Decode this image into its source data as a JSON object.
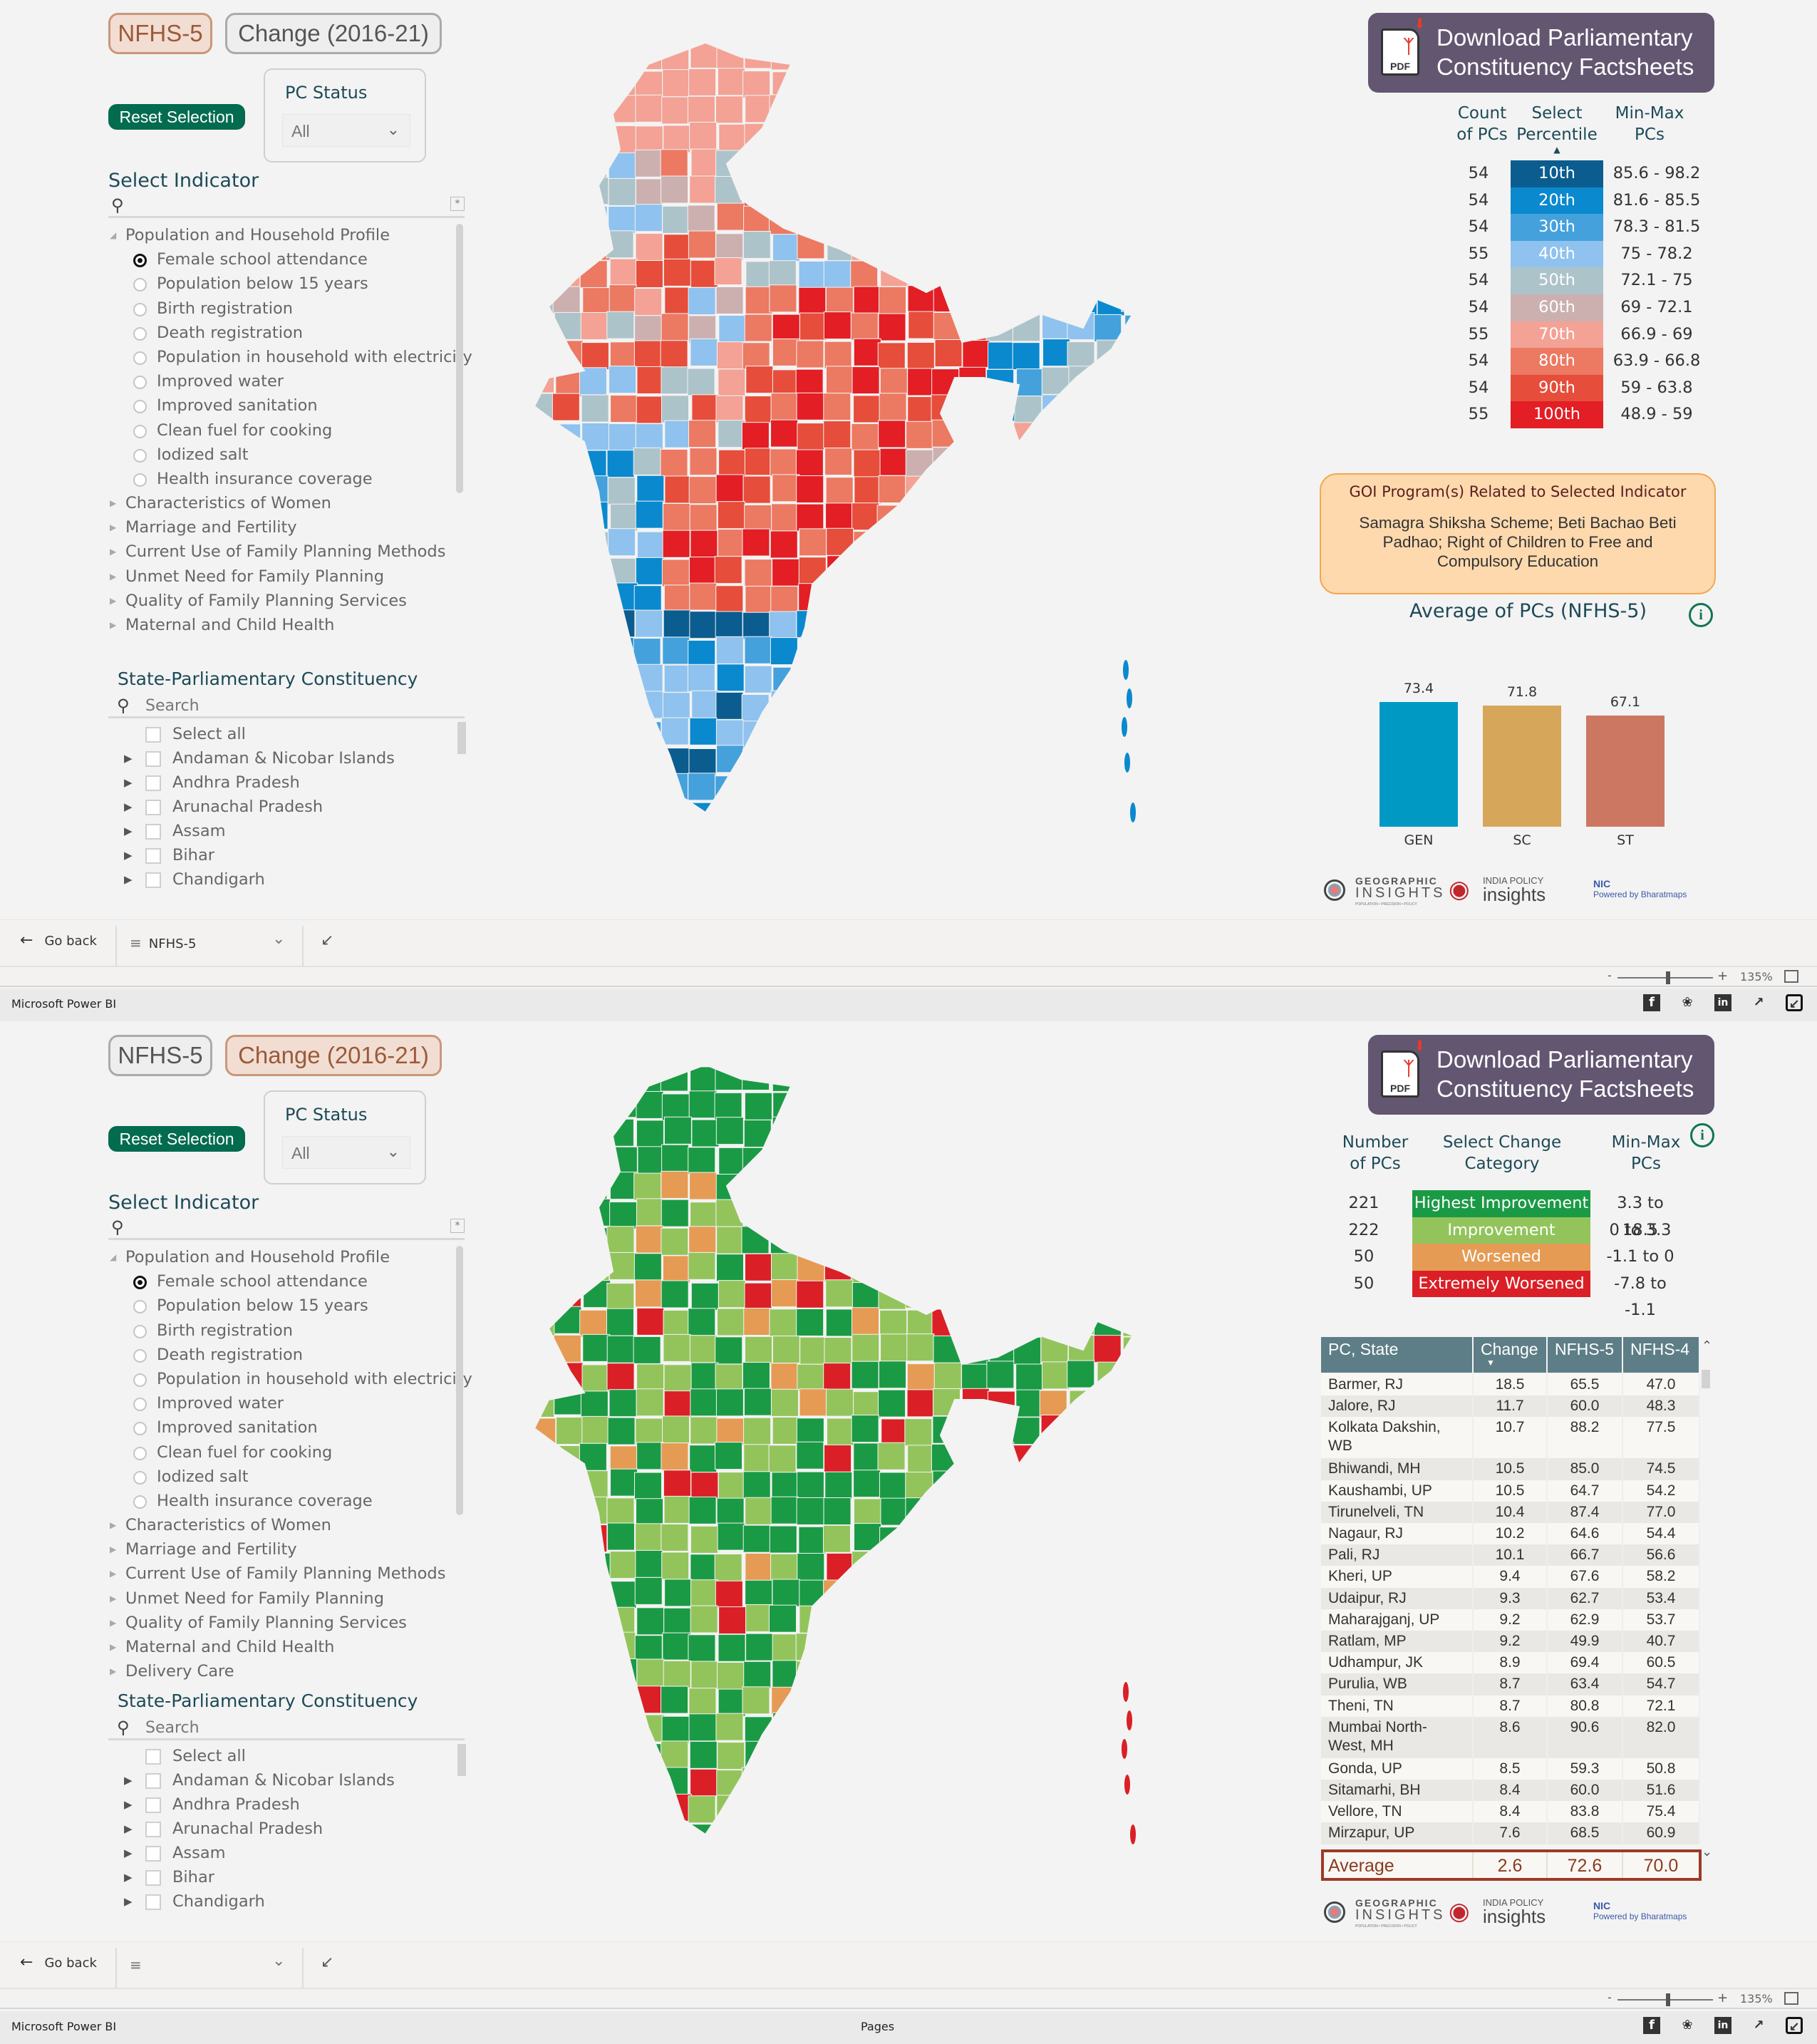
{
  "app": {
    "name": "Microsoft Power BI",
    "pages_label": "Pages"
  },
  "common": {
    "tabs": [
      {
        "label": "NFHS-5"
      },
      {
        "label": "Change (2016-21)"
      }
    ],
    "reset_label": "Reset Selection",
    "pc_status": {
      "title": "PC Status",
      "value": "All"
    },
    "select_indicator_title": "Select Indicator",
    "indicator_tree": {
      "expanded_group": "Population and Household Profile",
      "selected": "Female school attendance",
      "items": [
        "Female school attendance",
        "Population below 15 years",
        "Birth registration",
        "Death registration",
        "Population in household with electricity",
        "Improved water",
        "Improved sanitation",
        "Clean fuel for cooking",
        "Iodized salt",
        "Health insurance coverage"
      ],
      "collapsed_groups": [
        "Characteristics of Women",
        "Marriage and Fertility",
        "Current Use of Family Planning Methods",
        "Unmet Need for Family Planning",
        "Quality of Family Planning Services",
        "Maternal and Child Health",
        "Delivery Care"
      ]
    },
    "state_pc_title": "State-Parliamentary Constituency",
    "state_search_placeholder": "Search",
    "state_list": [
      "Select all",
      "Andaman & Nicobar Islands",
      "Andhra Pradesh",
      "Arunachal Pradesh",
      "Assam",
      "Bihar",
      "Chandigarh"
    ],
    "download_label_1": "Download Parliamentary",
    "download_label_2": "Constituency Factsheets",
    "pdf_label": "PDF",
    "logos": {
      "gi_top": "GEOGRAPHIC",
      "gi_main": "INSIGHTS",
      "gi_tag": "POPULATION • PRECISION • POLICY",
      "ipi_top": "INDIA POLICY",
      "ipi_main": "insights",
      "nic_top": "NIC",
      "nic_main": "Powered by Bharatmaps"
    },
    "go_back": "Go back",
    "zoom": {
      "percent": "135%",
      "level": 0.5
    }
  },
  "panel1": {
    "page_selector": "NFHS-5",
    "visible_indicator_groups": 6,
    "legend_headers": {
      "count": [
        "Count",
        "of PCs"
      ],
      "select": [
        "Select",
        "Percentile"
      ],
      "minmax": [
        "Min-Max",
        "PCs"
      ]
    },
    "legend": [
      {
        "count": "54",
        "label": "10th",
        "range": "85.6 - 98.2",
        "color": "#0b5d8f"
      },
      {
        "count": "54",
        "label": "20th",
        "range": "81.6 - 85.5",
        "color": "#0a89cf"
      },
      {
        "count": "54",
        "label": "30th",
        "range": "78.3 - 81.5",
        "color": "#44a1dc"
      },
      {
        "count": "55",
        "label": "40th",
        "range": "75 - 78.2",
        "color": "#8fc2ee"
      },
      {
        "count": "54",
        "label": "50th",
        "range": "72.1 - 75",
        "color": "#adc3ca"
      },
      {
        "count": "54",
        "label": "60th",
        "range": "69 - 72.1",
        "color": "#ccb0b0"
      },
      {
        "count": "55",
        "label": "70th",
        "range": "66.9 - 69",
        "color": "#f3a295"
      },
      {
        "count": "54",
        "label": "80th",
        "range": "63.9 - 66.8",
        "color": "#ec7962"
      },
      {
        "count": "54",
        "label": "90th",
        "range": "59 - 63.8",
        "color": "#e64d3a"
      },
      {
        "count": "55",
        "label": "100th",
        "range": "48.9 - 59",
        "color": "#e31e24"
      }
    ],
    "goi": {
      "title": "GOI Program(s) Related to Selected Indicator",
      "body": "Samagra Shiksha Scheme; Beti Bachao Beti Padhao; Right of Children to Free and Compulsory Education"
    },
    "chart_data": {
      "type": "bar",
      "title": "Average of PCs (NFHS-5)",
      "categories": [
        "GEN",
        "SC",
        "ST"
      ],
      "values": [
        73.4,
        71.8,
        67.1
      ],
      "labels": [
        "73.4",
        "71.8",
        "67.1"
      ],
      "colors": [
        "#0099c4",
        "#d6a75a",
        "#cc7762"
      ],
      "xlabel": "",
      "ylabel": "",
      "ylim": [
        0,
        80
      ],
      "grid": false
    }
  },
  "panel2": {
    "page_selector": "",
    "legend_headers": {
      "count": [
        "Number",
        "of PCs"
      ],
      "select": [
        "Select Change",
        "Category"
      ],
      "minmax": [
        "Min-Max",
        "PCs"
      ]
    },
    "legend": [
      {
        "count": "221",
        "label": "Highest Improvement",
        "range": "3.3 to 18.5",
        "color": "#1b9a45"
      },
      {
        "count": "222",
        "label": "Improvement",
        "range": "0 to 3.3",
        "color": "#93c45c"
      },
      {
        "count": "50",
        "label": "Worsened",
        "range": "-1.1 to 0",
        "color": "#e59b54"
      },
      {
        "count": "50",
        "label": "Extremely Worsened",
        "range": "-7.8 to -1.1",
        "color": "#db1f26"
      }
    ],
    "table": {
      "headers": [
        "PC, State",
        "Change",
        "NFHS-5",
        "NFHS-4"
      ],
      "sorted_by": "Change",
      "rows": [
        [
          "Barmer, RJ",
          "18.5",
          "65.5",
          "47.0"
        ],
        [
          "Jalore, RJ",
          "11.7",
          "60.0",
          "48.3"
        ],
        [
          "Kolkata Dakshin, WB",
          "10.7",
          "88.2",
          "77.5"
        ],
        [
          "Bhiwandi, MH",
          "10.5",
          "85.0",
          "74.5"
        ],
        [
          "Kaushambi, UP",
          "10.5",
          "64.7",
          "54.2"
        ],
        [
          "Tirunelveli, TN",
          "10.4",
          "87.4",
          "77.0"
        ],
        [
          "Nagaur, RJ",
          "10.2",
          "64.6",
          "54.4"
        ],
        [
          "Pali, RJ",
          "10.1",
          "66.7",
          "56.6"
        ],
        [
          "Kheri, UP",
          "9.4",
          "67.6",
          "58.2"
        ],
        [
          "Udaipur, RJ",
          "9.3",
          "62.7",
          "53.4"
        ],
        [
          "Maharajganj, UP",
          "9.2",
          "62.9",
          "53.7"
        ],
        [
          "Ratlam, MP",
          "9.2",
          "49.9",
          "40.7"
        ],
        [
          "Udhampur, JK",
          "8.9",
          "69.4",
          "60.5"
        ],
        [
          "Purulia, WB",
          "8.7",
          "63.4",
          "54.7"
        ],
        [
          "Theni, TN",
          "8.7",
          "80.8",
          "72.1"
        ],
        [
          "Mumbai North-West, MH",
          "8.6",
          "90.6",
          "82.0"
        ],
        [
          "Gonda, UP",
          "8.5",
          "59.3",
          "50.8"
        ],
        [
          "Sitamarhi, BH",
          "8.4",
          "60.0",
          "51.6"
        ],
        [
          "Vellore, TN",
          "8.4",
          "83.8",
          "75.4"
        ],
        [
          "Mirzapur, UP",
          "7.6",
          "68.5",
          "60.9"
        ]
      ],
      "average": [
        "Average",
        "2.6",
        "72.6",
        "70.0"
      ]
    }
  }
}
